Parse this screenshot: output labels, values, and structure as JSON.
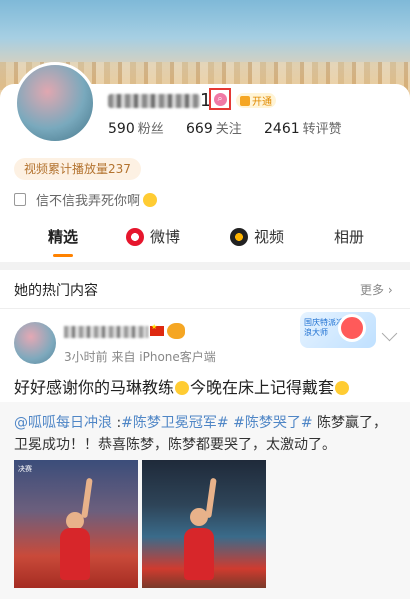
{
  "profile": {
    "name_suffix": "1",
    "vip_label": "开通",
    "stats": [
      {
        "value": "590",
        "label": "粉丝"
      },
      {
        "value": "669",
        "label": "关注"
      },
      {
        "value": "2461",
        "label": "转评赞"
      }
    ],
    "play_count": "视频累计播放量237",
    "signature": "信不信我弄死你啊"
  },
  "tabs": [
    {
      "label": "精选",
      "icon": "none",
      "active": true
    },
    {
      "label": "微博",
      "icon": "weibo-icon"
    },
    {
      "label": "视频",
      "icon": "video-icon"
    },
    {
      "label": "相册",
      "icon": "none"
    }
  ],
  "hot": {
    "title": "她的热门内容",
    "more": "更多 ›"
  },
  "post": {
    "meta": "3小时前  来自 iPhone客户端",
    "text_part1": "好好感谢你的马琳教练",
    "text_part2": "今晚在床上记得戴套",
    "event_badge": "国庆特派冲浪大师"
  },
  "repost": {
    "mention": "@呱呱每日冲浪",
    "colon": " :",
    "hashtag1": "#陈梦卫冕冠军#",
    "hashtag2": "#陈梦哭了#",
    "text": " 陈梦赢了，卫冕成功！！恭喜陈梦，陈梦都要哭了，太激动了。",
    "photo1_caption": "决赛",
    "photo2_caption": ""
  }
}
